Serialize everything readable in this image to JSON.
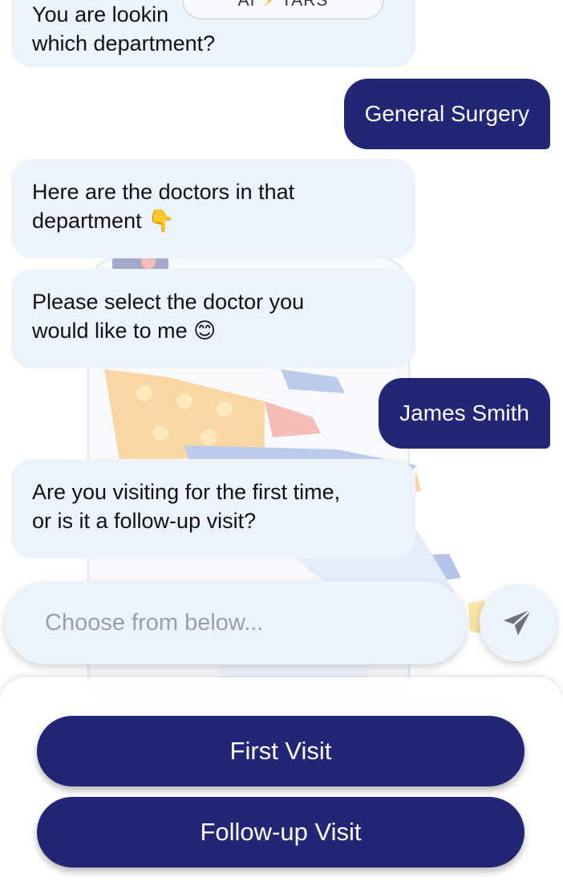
{
  "messages": [
    {
      "from": "bot",
      "lines": [
        "You are lookin",
        "which department?"
      ]
    },
    {
      "from": "user",
      "text": "General Surgery"
    },
    {
      "from": "bot",
      "lines": [
        "Here are the doctors in that",
        "department 👇"
      ]
    },
    {
      "from": "bot",
      "lines": [
        "Please select the doctor you",
        "would like to me 😊"
      ]
    },
    {
      "from": "user",
      "text": "James Smith"
    },
    {
      "from": "bot",
      "lines": [
        "Are you visiting for the first time,",
        "or is it a follow-up visit?"
      ]
    }
  ],
  "badge": {
    "left": "AI",
    "bolt": "⚡",
    "right": "TARS"
  },
  "composer": {
    "placeholder": "Choose from below...",
    "send_icon": "paper-plane-icon"
  },
  "choices": [
    "First Visit",
    "Follow-up Visit"
  ],
  "colors": {
    "primary": "#212776",
    "bot_bubble": "#edf3fb",
    "text": "#111111"
  }
}
